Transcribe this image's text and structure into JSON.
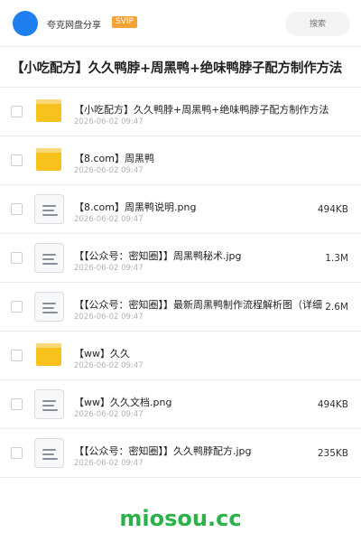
{
  "header": {
    "username": "夸克网盘分享",
    "badge": "SVIP",
    "search_placeholder": "搜索"
  },
  "title": "【小吃配方】久久鸭脖+周黑鸭+绝味鸭脖子配方制作方法",
  "files": [
    {
      "type": "folder",
      "name": "【小吃配方】久久鸭脖+周黑鸭+绝味鸭脖子配方制作方法",
      "date": "2026-06-02 09:47",
      "size": ""
    },
    {
      "type": "folder",
      "name": "【8.com】周黑鸭",
      "date": "2026-06-02 09:47",
      "size": ""
    },
    {
      "type": "file",
      "name": "【8.com】周黑鸭说明.png",
      "date": "2026-06-02 09:47",
      "size": "494KB"
    },
    {
      "type": "file",
      "name": "【【公众号：密知圈】】周黑鸭秘术.jpg",
      "date": "2026-06-02 09:47",
      "size": "1.3M"
    },
    {
      "type": "file",
      "name": "【【公众号：密知圈】】最新周黑鸭制作流程解析图（详细",
      "date": "2026-06-02 09:47",
      "size": "2.6M"
    },
    {
      "type": "folder",
      "name": "【ww】久久",
      "date": "2026-06-02 09:47",
      "size": ""
    },
    {
      "type": "file",
      "name": "【ww】久久文档.png",
      "date": "2026-06-02 09:47",
      "size": "494KB"
    },
    {
      "type": "file",
      "name": "【【公众号：密知圈】】久久鸭脖配方.jpg",
      "date": "2026-06-02 09:47",
      "size": "235KB"
    }
  ],
  "footer": {
    "watermark": "miosou.cc"
  },
  "colors": {
    "accent": "#1e7ff0",
    "badge": "#f7a33a",
    "folder": "#f8c21c",
    "watermark": "#2bb34a"
  }
}
